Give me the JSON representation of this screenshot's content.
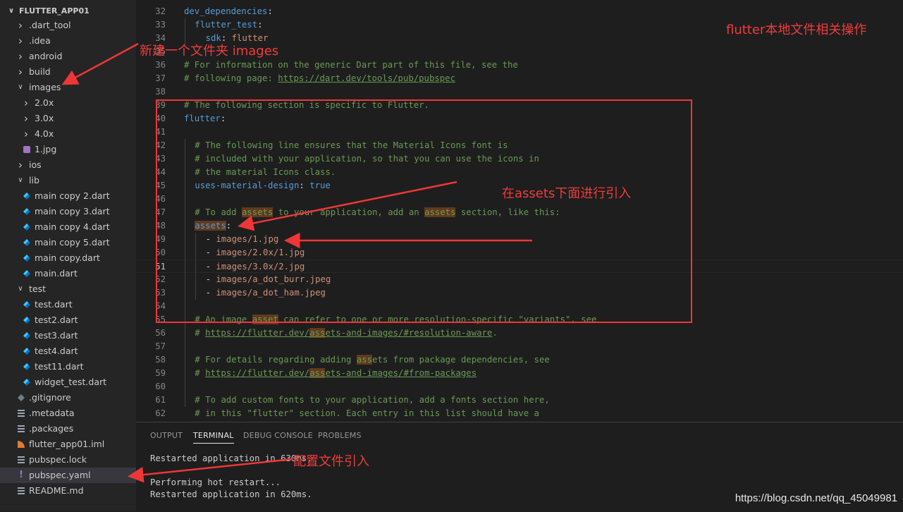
{
  "explorer": {
    "root": "FLUTTER_APP01",
    "items": [
      {
        "label": ".dart_tool",
        "kind": "folder",
        "expanded": false,
        "depth": 1,
        "icon": "chevron-right-icon"
      },
      {
        "label": ".idea",
        "kind": "folder",
        "expanded": false,
        "depth": 1,
        "icon": "chevron-right-icon"
      },
      {
        "label": "android",
        "kind": "folder",
        "expanded": false,
        "depth": 1,
        "icon": "chevron-right-icon"
      },
      {
        "label": "build",
        "kind": "folder",
        "expanded": false,
        "depth": 1,
        "icon": "chevron-right-icon"
      },
      {
        "label": "images",
        "kind": "folder",
        "expanded": true,
        "depth": 1,
        "icon": "chevron-down-icon"
      },
      {
        "label": "2.0x",
        "kind": "folder",
        "expanded": false,
        "depth": 2,
        "icon": "chevron-right-icon"
      },
      {
        "label": "3.0x",
        "kind": "folder",
        "expanded": false,
        "depth": 2,
        "icon": "chevron-right-icon"
      },
      {
        "label": "4.0x",
        "kind": "folder",
        "expanded": false,
        "depth": 2,
        "icon": "chevron-right-icon"
      },
      {
        "label": "1.jpg",
        "kind": "file",
        "depth": 2,
        "icon": "image-file-icon"
      },
      {
        "label": "ios",
        "kind": "folder",
        "expanded": false,
        "depth": 1,
        "icon": "chevron-right-icon"
      },
      {
        "label": "lib",
        "kind": "folder",
        "expanded": true,
        "depth": 1,
        "icon": "chevron-down-icon"
      },
      {
        "label": "main copy 2.dart",
        "kind": "file",
        "depth": 2,
        "icon": "dart-file-icon"
      },
      {
        "label": "main copy 3.dart",
        "kind": "file",
        "depth": 2,
        "icon": "dart-file-icon"
      },
      {
        "label": "main copy 4.dart",
        "kind": "file",
        "depth": 2,
        "icon": "dart-file-icon"
      },
      {
        "label": "main copy 5.dart",
        "kind": "file",
        "depth": 2,
        "icon": "dart-file-icon"
      },
      {
        "label": "main copy.dart",
        "kind": "file",
        "depth": 2,
        "icon": "dart-file-icon"
      },
      {
        "label": "main.dart",
        "kind": "file",
        "depth": 2,
        "icon": "dart-file-icon"
      },
      {
        "label": "test",
        "kind": "folder",
        "expanded": true,
        "depth": 1,
        "icon": "chevron-down-icon"
      },
      {
        "label": "test.dart",
        "kind": "file",
        "depth": 2,
        "icon": "dart-file-icon"
      },
      {
        "label": "test2.dart",
        "kind": "file",
        "depth": 2,
        "icon": "dart-file-icon"
      },
      {
        "label": "test3.dart",
        "kind": "file",
        "depth": 2,
        "icon": "dart-file-icon"
      },
      {
        "label": "test4.dart",
        "kind": "file",
        "depth": 2,
        "icon": "dart-file-icon"
      },
      {
        "label": "test11.dart",
        "kind": "file",
        "depth": 2,
        "icon": "dart-file-icon"
      },
      {
        "label": "widget_test.dart",
        "kind": "file",
        "depth": 2,
        "icon": "dart-file-icon"
      },
      {
        "label": ".gitignore",
        "kind": "file",
        "depth": 1,
        "icon": "git-file-icon"
      },
      {
        "label": ".metadata",
        "kind": "file",
        "depth": 1,
        "icon": "text-file-icon"
      },
      {
        "label": ".packages",
        "kind": "file",
        "depth": 1,
        "icon": "text-file-icon"
      },
      {
        "label": "flutter_app01.iml",
        "kind": "file",
        "depth": 1,
        "icon": "rss-file-icon"
      },
      {
        "label": "pubspec.lock",
        "kind": "file",
        "depth": 1,
        "icon": "text-file-icon"
      },
      {
        "label": "pubspec.yaml",
        "kind": "file",
        "depth": 1,
        "icon": "yaml-file-icon",
        "selected": true
      },
      {
        "label": "README.md",
        "kind": "file",
        "depth": 1,
        "icon": "markdown-file-icon"
      }
    ]
  },
  "editor": {
    "active_line": "51",
    "lines": [
      {
        "num": "32",
        "indent": 0,
        "tokens": [
          {
            "t": "dev_dependencies",
            "c": "key"
          },
          {
            "t": ":",
            "c": ""
          }
        ]
      },
      {
        "num": "33",
        "indent": 2,
        "tokens": [
          {
            "t": "flutter_test",
            "c": "key"
          },
          {
            "t": ":",
            "c": ""
          }
        ]
      },
      {
        "num": "34",
        "indent": 4,
        "tokens": [
          {
            "t": "sdk",
            "c": "key"
          },
          {
            "t": ": ",
            "c": ""
          },
          {
            "t": "flutter",
            "c": "val"
          }
        ]
      },
      {
        "num": "35",
        "indent": 0,
        "tokens": []
      },
      {
        "num": "36",
        "indent": 0,
        "tokens": [
          {
            "t": "# For information on the generic Dart part of this file, see the",
            "c": "cm"
          }
        ]
      },
      {
        "num": "37",
        "indent": 0,
        "tokens": [
          {
            "t": "# following page: ",
            "c": "cm"
          },
          {
            "t": "https://dart.dev/tools/pub/pubspec",
            "c": "cm lnk"
          }
        ]
      },
      {
        "num": "38",
        "indent": 0,
        "tokens": []
      },
      {
        "num": "39",
        "indent": 0,
        "tokens": [
          {
            "t": "# The following section is specific to Flutter.",
            "c": "cm"
          }
        ]
      },
      {
        "num": "40",
        "indent": 0,
        "tokens": [
          {
            "t": "flutter",
            "c": "key"
          },
          {
            "t": ":",
            "c": ""
          }
        ]
      },
      {
        "num": "41",
        "indent": 0,
        "tokens": []
      },
      {
        "num": "42",
        "indent": 2,
        "tokens": [
          {
            "t": "# The following line ensures that the Material Icons font is",
            "c": "cm"
          }
        ]
      },
      {
        "num": "43",
        "indent": 2,
        "tokens": [
          {
            "t": "# included with your application, so that you can use the icons in",
            "c": "cm"
          }
        ]
      },
      {
        "num": "44",
        "indent": 2,
        "tokens": [
          {
            "t": "# the material Icons class.",
            "c": "cm"
          }
        ]
      },
      {
        "num": "45",
        "indent": 2,
        "tokens": [
          {
            "t": "uses-material-design",
            "c": "key"
          },
          {
            "t": ": ",
            "c": ""
          },
          {
            "t": "true",
            "c": "bool"
          }
        ]
      },
      {
        "num": "46",
        "indent": 0,
        "tokens": []
      },
      {
        "num": "47",
        "indent": 2,
        "tokens": [
          {
            "t": "# To add ",
            "c": "cm"
          },
          {
            "t": "assets",
            "c": "cm hl"
          },
          {
            "t": " to your application, add an ",
            "c": "cm"
          },
          {
            "t": "assets",
            "c": "cm hl"
          },
          {
            "t": " section, like this:",
            "c": "cm"
          }
        ]
      },
      {
        "num": "48",
        "indent": 2,
        "tokens": [
          {
            "t": "assets",
            "c": "key hl"
          },
          {
            "t": ":",
            "c": ""
          }
        ]
      },
      {
        "num": "49",
        "indent": 4,
        "tokens": [
          {
            "t": "- ",
            "c": ""
          },
          {
            "t": "images/1.jpg",
            "c": "val"
          }
        ]
      },
      {
        "num": "50",
        "indent": 4,
        "tokens": [
          {
            "t": "- ",
            "c": ""
          },
          {
            "t": "images/2.0x/1.jpg",
            "c": "val"
          }
        ]
      },
      {
        "num": "51",
        "indent": 4,
        "tokens": [
          {
            "t": "- ",
            "c": ""
          },
          {
            "t": "images/3.0x/2.jpg",
            "c": "val"
          }
        ]
      },
      {
        "num": "52",
        "indent": 4,
        "tokens": [
          {
            "t": "- ",
            "c": ""
          },
          {
            "t": "images/a_dot_burr.jpeg",
            "c": "val"
          }
        ]
      },
      {
        "num": "53",
        "indent": 4,
        "tokens": [
          {
            "t": "- ",
            "c": ""
          },
          {
            "t": "images/a_dot_ham.jpeg",
            "c": "val"
          }
        ]
      },
      {
        "num": "54",
        "indent": 0,
        "tokens": []
      },
      {
        "num": "55",
        "indent": 2,
        "tokens": [
          {
            "t": "# An image ",
            "c": "cm"
          },
          {
            "t": "asset",
            "c": "cm hl"
          },
          {
            "t": " can refer to one or more resolution-specific \"variants\", see",
            "c": "cm"
          }
        ]
      },
      {
        "num": "56",
        "indent": 2,
        "tokens": [
          {
            "t": "# ",
            "c": "cm"
          },
          {
            "t": "https://flutter.dev/",
            "c": "cm lnk"
          },
          {
            "t": "ass",
            "c": "cm lnk hl"
          },
          {
            "t": "ets-and-images/#resolution-aware",
            "c": "cm lnk"
          },
          {
            "t": ".",
            "c": "cm"
          }
        ]
      },
      {
        "num": "57",
        "indent": 0,
        "tokens": []
      },
      {
        "num": "58",
        "indent": 2,
        "tokens": [
          {
            "t": "# For details regarding adding ",
            "c": "cm"
          },
          {
            "t": "ass",
            "c": "cm hl"
          },
          {
            "t": "ets from package dependencies, see",
            "c": "cm"
          }
        ]
      },
      {
        "num": "59",
        "indent": 2,
        "tokens": [
          {
            "t": "# ",
            "c": "cm"
          },
          {
            "t": "https://flutter.dev/",
            "c": "cm lnk"
          },
          {
            "t": "ass",
            "c": "cm lnk hl"
          },
          {
            "t": "ets-and-images/#from-packages",
            "c": "cm lnk"
          }
        ]
      },
      {
        "num": "60",
        "indent": 0,
        "tokens": []
      },
      {
        "num": "61",
        "indent": 2,
        "tokens": [
          {
            "t": "# To add custom fonts to your application, add a fonts section here,",
            "c": "cm"
          }
        ]
      },
      {
        "num": "62",
        "indent": 2,
        "tokens": [
          {
            "t": "# in this \"flutter\" section. Each entry in this list should have a",
            "c": "cm"
          }
        ]
      }
    ]
  },
  "panel": {
    "tabs": [
      "OUTPUT",
      "TERMINAL",
      "DEBUG CONSOLE",
      "PROBLEMS"
    ],
    "active_tab": "TERMINAL",
    "terminal_lines": [
      "Restarted application in 630ms.",
      "",
      "Performing hot restart...",
      "Restarted application in 620ms."
    ]
  },
  "annotations": {
    "title": "flutter本地文件相关操作",
    "new_folder": "新建一个文件夹 images",
    "assets_note": "在assets下面进行引入",
    "config_note": "配置文件引入",
    "color": "#ef3636"
  },
  "watermark": "https://blog.csdn.net/qq_45049981"
}
